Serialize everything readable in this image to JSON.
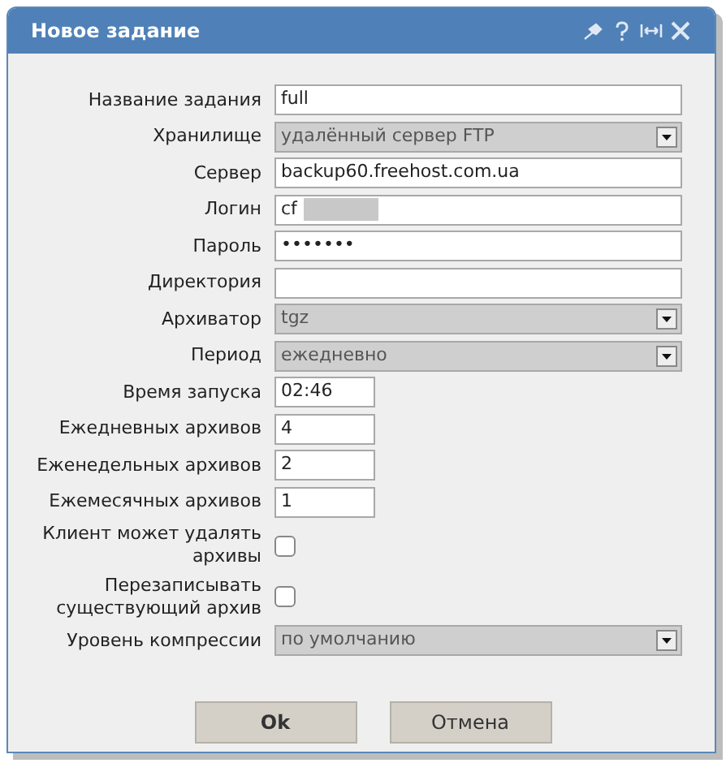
{
  "window": {
    "title": "Новое задание"
  },
  "fields": [
    {
      "label": "Название задания",
      "kind": "text",
      "value": "full"
    },
    {
      "label": "Хранилище",
      "kind": "select",
      "value": "удалённый сервер FTP"
    },
    {
      "label": "Сервер",
      "kind": "text",
      "value": "backup60.freehost.com.ua"
    },
    {
      "label": "Логин",
      "kind": "text",
      "value": "cf",
      "redacted": true
    },
    {
      "label": "Пароль",
      "kind": "text",
      "value": "•••••••"
    },
    {
      "label": "Директория",
      "kind": "text"
    },
    {
      "label": "Архиватор",
      "kind": "select",
      "value": "tgz"
    },
    {
      "label": "Период",
      "kind": "select",
      "value": "ежедневно"
    },
    {
      "label": "Время запуска",
      "kind": "number",
      "value": "02:46"
    },
    {
      "label": "Ежедневных архивов",
      "kind": "number",
      "value": "4"
    },
    {
      "label": "Еженедельных архивов",
      "kind": "number",
      "value": "2"
    },
    {
      "label": "Ежемесячных архивов",
      "kind": "number",
      "value": "1"
    },
    {
      "label": "Клиент может удалять архивы",
      "kind": "checkbox",
      "checked": false
    },
    {
      "label": "Перезаписывать существующий архив",
      "kind": "checkbox",
      "checked": false
    },
    {
      "label": "Уровень компрессии",
      "kind": "select",
      "value": "по умолчанию"
    }
  ],
  "buttons": [
    {
      "label": "Ok",
      "primary": true
    },
    {
      "label": "Отмена",
      "primary": false
    }
  ]
}
